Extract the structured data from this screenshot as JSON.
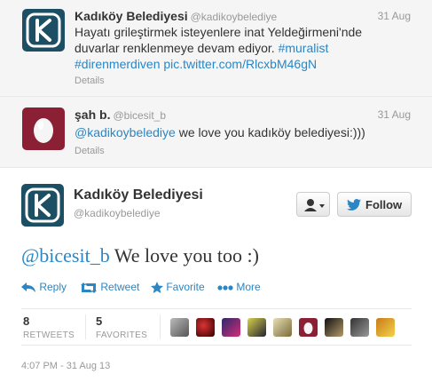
{
  "tweets": [
    {
      "name": "Kadıköy Belediyesi",
      "handle": "@kadikoybelediye",
      "date": "31 Aug",
      "line1": "Hayatı grileştirmek isteyenlere inat Yeldeğirmeni'nde",
      "line2_text": "duvarlar renklenmeye devam ediyor. ",
      "line2_link": "#muralist",
      "line3_link": "#direnmerdiven pic.twitter.com/RlcxbM46gN",
      "details": "Details"
    },
    {
      "name": "şah b.",
      "handle": "@bicesit_b",
      "date": "31 Aug",
      "mention": "@kadikoybelediye",
      "text": " we love you kadıköy belediyesi:)))",
      "details": "Details"
    }
  ],
  "main": {
    "name": "Kadıköy Belediyesi",
    "handle": "@kadikoybelediye",
    "follow_label": "Follow",
    "mention": "@bicesit_b",
    "text": " We love you too :)",
    "actions": {
      "reply": "Reply",
      "retweet": "Retweet",
      "favorite": "Favorite",
      "more": "More"
    },
    "stats": {
      "retweets_count": "8",
      "retweets_label": "RETWEETS",
      "favorites_count": "5",
      "favorites_label": "FAVORITES"
    },
    "timestamp": "4:07 PM - 31 Aug 13"
  },
  "colors": {
    "link": "#2a86c4",
    "brand": "#1c4f63"
  },
  "icons": [
    "k-logo",
    "egg-avatar",
    "user-icon",
    "caret-down-icon",
    "twitter-bird-icon",
    "reply-icon",
    "retweet-icon",
    "star-icon",
    "dots-icon"
  ]
}
